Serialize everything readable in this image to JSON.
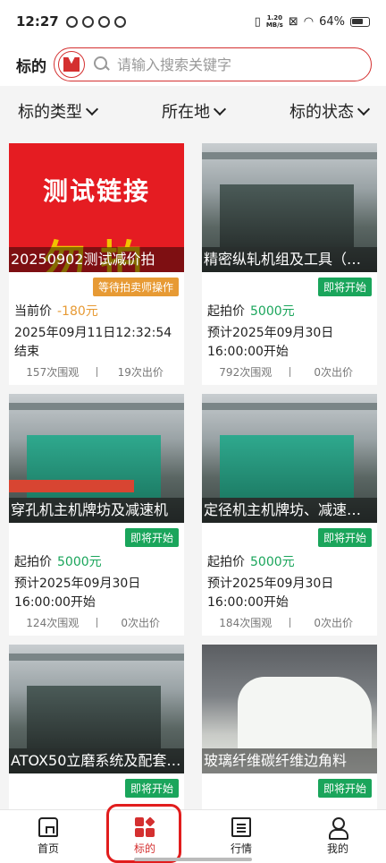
{
  "status_bar": {
    "time": "12:27",
    "net_speed_value": "1.20",
    "net_speed_unit": "MB/s",
    "battery": "64%"
  },
  "search": {
    "label": "标的",
    "placeholder": "请输入搜索关键字",
    "accent_color": "#d43030"
  },
  "filters": [
    {
      "label": "标的类型"
    },
    {
      "label": "所在地"
    },
    {
      "label": "标的状态"
    }
  ],
  "cards": [
    {
      "image_text": "测试链接",
      "image_watermark": "勿拍",
      "title": "20250902测试减价拍",
      "badge": "等待拍卖师操作",
      "badge_color": "orange",
      "price_label": "当前价",
      "price_value": "-180元",
      "time_text": "2025年09月11日12:32:54结束",
      "views": "157次围观",
      "bids": "19次出价"
    },
    {
      "title": "精密纵轧机组及工具（…",
      "badge": "即将开始",
      "badge_color": "green",
      "price_label": "起拍价",
      "price_value": "5000元",
      "time_text": "预计2025年09月30日16:00:00开始",
      "views": "792次围观",
      "bids": "0次出价"
    },
    {
      "title": "穿孔机主机牌坊及减速机",
      "badge": "即将开始",
      "badge_color": "green",
      "price_label": "起拍价",
      "price_value": "5000元",
      "time_text": "预计2025年09月30日16:00:00开始",
      "views": "124次围观",
      "bids": "0次出价"
    },
    {
      "title": "定径机主机牌坊、减速…",
      "badge": "即将开始",
      "badge_color": "green",
      "price_label": "起拍价",
      "price_value": "5000元",
      "time_text": "预计2025年09月30日16:00:00开始",
      "views": "184次围观",
      "bids": "0次出价"
    },
    {
      "title": "ATOX50立磨系统及配套…",
      "badge": "即将开始",
      "badge_color": "green"
    },
    {
      "title": "玻璃纤维碳纤维边角料",
      "badge": "即将开始",
      "badge_color": "green"
    }
  ],
  "bottom_nav": [
    {
      "label": "首页",
      "icon": "home-icon"
    },
    {
      "label": "标的",
      "icon": "grid-icon",
      "active": true
    },
    {
      "label": "行情",
      "icon": "news-icon"
    },
    {
      "label": "我的",
      "icon": "user-icon"
    }
  ],
  "colors": {
    "green": "#1aa55b",
    "orange": "#e79a34",
    "red": "#d43030"
  }
}
